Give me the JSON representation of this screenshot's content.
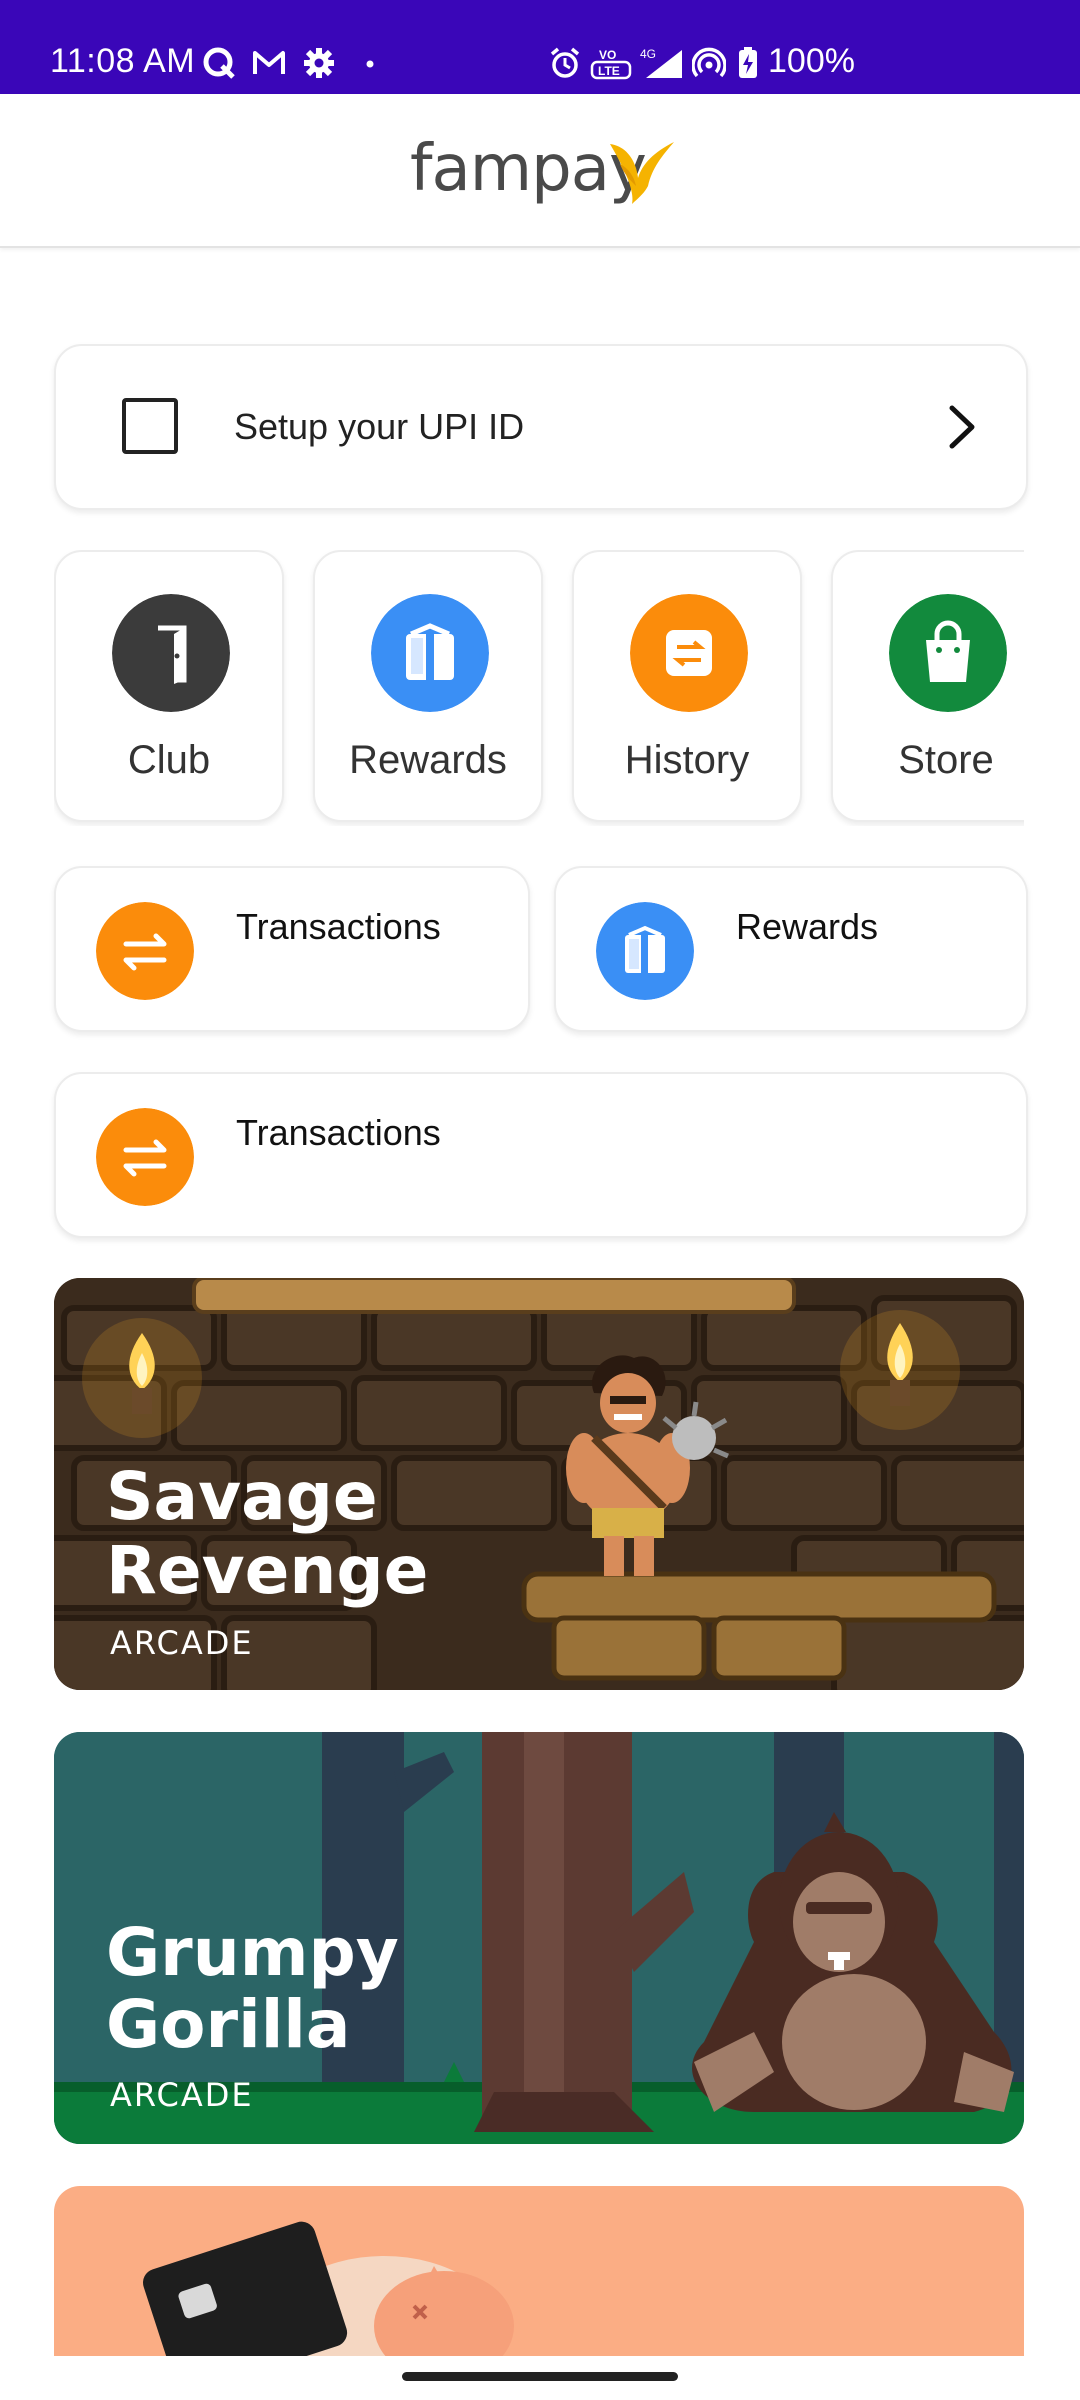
{
  "status_bar": {
    "time": "11:08 AM",
    "left_icons": [
      "q-app-icon",
      "gmail-icon",
      "settings-icon",
      "dot-icon"
    ],
    "right_icons": [
      "alarm-icon",
      "volte-icon",
      "4g-signal-icon",
      "hotspot-icon",
      "battery-charging-icon"
    ],
    "network": "4G",
    "battery": "100%",
    "bg_color": "#3a06b8"
  },
  "header": {
    "logo_text": "fampay",
    "logo_color": "#f5b301"
  },
  "upi": {
    "label": "Setup your UPI ID"
  },
  "quick_tiles": [
    {
      "label": "Club",
      "icon": "door-icon",
      "color": "#3b3b3b"
    },
    {
      "label": "Rewards",
      "icon": "gift-icon",
      "color": "#3a8ff5"
    },
    {
      "label": "History",
      "icon": "history-icon",
      "color": "#fb8c0b"
    },
    {
      "label": "Store",
      "icon": "shopping-bag-icon",
      "color": "#128a3d"
    }
  ],
  "actions": [
    {
      "label": "Transactions",
      "icon": "transfer-arrows-icon",
      "color": "#fb8c0b"
    },
    {
      "label": "Rewards",
      "icon": "gift-icon",
      "color": "#3a8ff5"
    },
    {
      "label": "Transactions",
      "icon": "transfer-arrows-icon",
      "color": "#fb8c0b"
    }
  ],
  "games": [
    {
      "title_line1": "Savage",
      "title_line2": "Revenge",
      "category": "ARCADE"
    },
    {
      "title_line1": "Grumpy",
      "title_line2": "Gorilla",
      "category": "ARCADE"
    }
  ]
}
